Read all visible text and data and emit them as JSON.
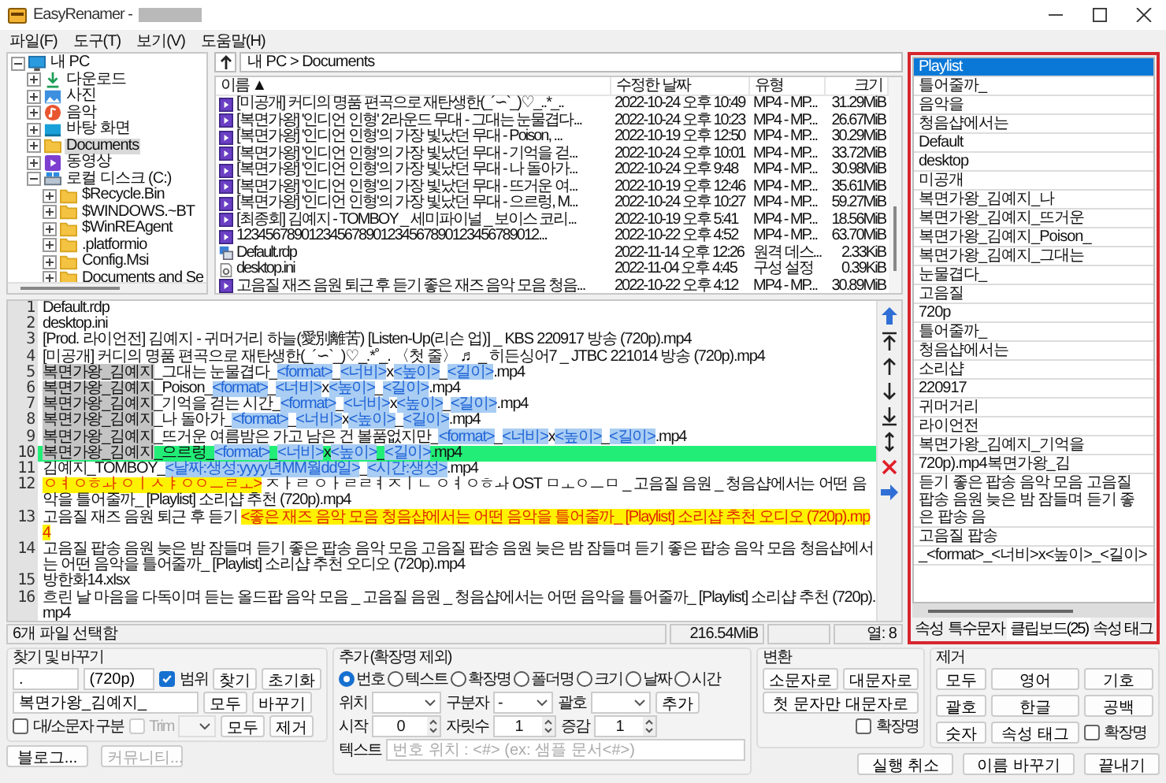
{
  "window": {
    "title": "EasyRenamer -"
  },
  "menu": [
    "파일(F)",
    "도구(T)",
    "보기(V)",
    "도움말(H)"
  ],
  "tree": [
    {
      "label": "내 PC",
      "kind": "pc",
      "expanded": true,
      "selected": false,
      "children": [
        {
          "label": "다운로드",
          "kind": "download",
          "expanded": false,
          "selected": false
        },
        {
          "label": "사진",
          "kind": "picture",
          "expanded": false,
          "selected": false
        },
        {
          "label": "음악",
          "kind": "music",
          "expanded": false,
          "selected": false
        },
        {
          "label": "바탕 화면",
          "kind": "desktop",
          "expanded": false,
          "selected": false
        },
        {
          "label": "Documents",
          "kind": "folder",
          "expanded": false,
          "selected": true
        },
        {
          "label": "동영상",
          "kind": "video",
          "expanded": false,
          "selected": false
        },
        {
          "label": "로컬 디스크 (C:)",
          "kind": "drive",
          "expanded": true,
          "selected": false,
          "children": [
            {
              "label": "$Recycle.Bin",
              "kind": "folder",
              "expanded": false,
              "selected": false
            },
            {
              "label": "$WINDOWS.~BT",
              "kind": "folder",
              "expanded": false,
              "selected": false
            },
            {
              "label": "$WinREAgent",
              "kind": "folder",
              "expanded": false,
              "selected": false
            },
            {
              "label": ".platformio",
              "kind": "folder",
              "expanded": false,
              "selected": false
            },
            {
              "label": "Config.Msi",
              "kind": "folder",
              "expanded": false,
              "selected": false
            },
            {
              "label": "Documents and Se",
              "kind": "folder",
              "expanded": false,
              "selected": false
            }
          ]
        }
      ]
    }
  ],
  "path_bar": {
    "path": "내 PC > Documents"
  },
  "file_list": {
    "columns": [
      "이름 ▲",
      "수정한 날짜",
      "유형",
      "크기"
    ],
    "rows": [
      {
        "kind": "video",
        "cells": [
          "[미공개] 커디의 명품 편곡으로 재탄생한(_´∽`_)♡_..*_..",
          "2022-10-24 오후 10:49",
          "MP4 - MP...",
          "31.29MiB"
        ]
      },
      {
        "kind": "video",
        "cells": [
          "[복면가왕] '인디언 인형' 2라운드 무대 - 그대는 눈물겹다...",
          "2022-10-24 오후 10:23",
          "MP4 - MP...",
          "26.67MiB"
        ]
      },
      {
        "kind": "video",
        "cells": [
          "[복면가왕] '인디언 인형'의 가장 빛났던 무대 - Poison, ...",
          "2022-10-19 오후 12:50",
          "MP4 - MP...",
          "30.29MiB"
        ]
      },
      {
        "kind": "video",
        "cells": [
          "[복면가왕] '인디언 인형'의 가장 빛났던 무대 - 기억을 걷...",
          "2022-10-24 오후 10:01",
          "MP4 - MP...",
          "33.72MiB"
        ]
      },
      {
        "kind": "video",
        "cells": [
          "[복면가왕] '인디언 인형'의 가장 빛났던 무대 - 나 돌아가...",
          "2022-10-24 오후 9:48",
          "MP4 - MP...",
          "30.98MiB"
        ]
      },
      {
        "kind": "video",
        "cells": [
          "[복면가왕] '인디언 인형'의 가장 빛났던 무대 - 뜨거운 여...",
          "2022-10-19 오후 12:46",
          "MP4 - MP...",
          "35.61MiB"
        ]
      },
      {
        "kind": "video",
        "cells": [
          "[복면가왕] '인디언 인형'의 가장 빛났던 무대 - 으르렁, M...",
          "2022-10-24 오후 10:27",
          "MP4 - MP...",
          "59.27MiB"
        ]
      },
      {
        "kind": "video",
        "cells": [
          "[최종회] 김예지 - TOMBOY _ 세미파이널 _ 보이스 코리...",
          "2022-10-19 오후 5:41",
          "MP4 - MP...",
          "18.56MiB"
        ]
      },
      {
        "kind": "video",
        "cells": [
          "123456789012345678901234567890123456789012...",
          "2022-10-22 오후 4:52",
          "MP4 - MP...",
          "63.70MiB"
        ]
      },
      {
        "kind": "remote",
        "cells": [
          "Default.rdp",
          "2022-11-14 오후 12:26",
          "원격 데스...",
          "2.33KiB"
        ]
      },
      {
        "kind": "settings",
        "cells": [
          "desktop.ini",
          "2022-11-04 오후 4:45",
          "구성 설정",
          "0.39KiB"
        ]
      },
      {
        "kind": "video",
        "cells": [
          "고음질 재즈 음원 퇴근 후 듣기 좋은 재즈 음악 모음 청음...",
          "2022-10-22 오후 4:12",
          "MP4 - MP...",
          "30.89MiB"
        ]
      }
    ]
  },
  "editor": {
    "lines": [
      {
        "number": "1",
        "selected": false,
        "segments": [
          {
            "kind": "plain",
            "text": "Default.rdp"
          }
        ]
      },
      {
        "number": "2",
        "selected": false,
        "segments": [
          {
            "kind": "plain",
            "text": "desktop.ini"
          }
        ]
      },
      {
        "number": "3",
        "selected": false,
        "segments": [
          {
            "kind": "plain",
            "text": "[Prod. 라이언전] 김예지 - 귀머거리 하늘(愛別離苦) [Listen-Up(리슨 업)] _ KBS 220917 방송 (720p).mp4"
          }
        ]
      },
      {
        "number": "4",
        "selected": false,
        "segments": [
          {
            "kind": "plain",
            "text": "[미공개] 커디의 명품 편곡으로 재탄생한(_´∽`_)♡_.*˚_. 〈첫 줄〉 ♬ _ 히든싱어7 _ JTBC 221014 방송 (720p).mp4"
          }
        ]
      },
      {
        "number": "5",
        "selected": false,
        "segments": [
          {
            "kind": "sel",
            "text": "복면가왕_김예지"
          },
          {
            "kind": "plain",
            "text": "_그대는 눈물겹다_"
          },
          {
            "kind": "tag",
            "text": "<format>"
          },
          {
            "kind": "plain",
            "text": "_"
          },
          {
            "kind": "tag",
            "text": "<너비>"
          },
          {
            "kind": "plain",
            "text": "x"
          },
          {
            "kind": "tag",
            "text": "<높이>"
          },
          {
            "kind": "plain",
            "text": "_"
          },
          {
            "kind": "tag",
            "text": "<길이>"
          },
          {
            "kind": "plain",
            "text": ".mp4"
          }
        ]
      },
      {
        "number": "6",
        "selected": false,
        "segments": [
          {
            "kind": "sel",
            "text": "복면가왕_김예지"
          },
          {
            "kind": "plain",
            "text": "_Poison_"
          },
          {
            "kind": "tag",
            "text": "<format>"
          },
          {
            "kind": "plain",
            "text": "_"
          },
          {
            "kind": "tag",
            "text": "<너비>"
          },
          {
            "kind": "plain",
            "text": "x"
          },
          {
            "kind": "tag",
            "text": "<높이>"
          },
          {
            "kind": "plain",
            "text": "_"
          },
          {
            "kind": "tag",
            "text": "<길이>"
          },
          {
            "kind": "plain",
            "text": ".mp4"
          }
        ]
      },
      {
        "number": "7",
        "selected": false,
        "segments": [
          {
            "kind": "sel",
            "text": "복면가왕_김예지"
          },
          {
            "kind": "plain",
            "text": "_기억을 걷는 시간_"
          },
          {
            "kind": "tag",
            "text": "<format>"
          },
          {
            "kind": "plain",
            "text": "_"
          },
          {
            "kind": "tag",
            "text": "<너비>"
          },
          {
            "kind": "plain",
            "text": "x"
          },
          {
            "kind": "tag",
            "text": "<높이>"
          },
          {
            "kind": "plain",
            "text": "_"
          },
          {
            "kind": "tag",
            "text": "<길이>"
          },
          {
            "kind": "plain",
            "text": ".mp4"
          }
        ]
      },
      {
        "number": "8",
        "selected": false,
        "segments": [
          {
            "kind": "sel",
            "text": "복면가왕_김예지"
          },
          {
            "kind": "plain",
            "text": "_나 돌아가_"
          },
          {
            "kind": "tag",
            "text": "<format>"
          },
          {
            "kind": "plain",
            "text": "_"
          },
          {
            "kind": "tag",
            "text": "<너비>"
          },
          {
            "kind": "plain",
            "text": "x"
          },
          {
            "kind": "tag",
            "text": "<높이>"
          },
          {
            "kind": "plain",
            "text": "_"
          },
          {
            "kind": "tag",
            "text": "<길이>"
          },
          {
            "kind": "plain",
            "text": ".mp4"
          }
        ]
      },
      {
        "number": "9",
        "selected": false,
        "segments": [
          {
            "kind": "sel",
            "text": "복면가왕_김예지"
          },
          {
            "kind": "plain",
            "text": "_뜨거운 여름밤은 가고 남은 건 볼품없지만_"
          },
          {
            "kind": "tag",
            "text": "<format>"
          },
          {
            "kind": "plain",
            "text": "_"
          },
          {
            "kind": "tag",
            "text": "<너비>"
          },
          {
            "kind": "plain",
            "text": "x"
          },
          {
            "kind": "tag",
            "text": "<높이>"
          },
          {
            "kind": "plain",
            "text": "_"
          },
          {
            "kind": "tag",
            "text": "<길이>"
          },
          {
            "kind": "plain",
            "text": ".mp4"
          }
        ]
      },
      {
        "number": "10",
        "selected": true,
        "segments": [
          {
            "kind": "sel",
            "text": "복면가왕_김예지"
          },
          {
            "kind": "plain",
            "text": "_으르렁_"
          },
          {
            "kind": "tag",
            "text": "<format>"
          },
          {
            "kind": "plain",
            "text": "_"
          },
          {
            "kind": "tag",
            "text": "<너비>"
          },
          {
            "kind": "plain",
            "text": "x"
          },
          {
            "kind": "tag",
            "text": "<높이>"
          },
          {
            "kind": "plain",
            "text": "_"
          },
          {
            "kind": "tag",
            "text": "<길이>"
          },
          {
            "kind": "plain",
            "text": ".mp4"
          }
        ]
      },
      {
        "number": "11",
        "selected": false,
        "segments": [
          {
            "kind": "plain",
            "text": "김예지_TOMBOY_"
          },
          {
            "kind": "tag",
            "text": "<날짜:생성:yyyy년MM월dd일>"
          },
          {
            "kind": "plain",
            "text": "_"
          },
          {
            "kind": "tag",
            "text": "<시간:생성>"
          },
          {
            "kind": "plain",
            "text": ".mp4"
          }
        ]
      },
      {
        "number": "12",
        "selected": false,
        "segments": [
          {
            "kind": "mark",
            "text": "ㅇㅕㅇㅎㅘ ㅇㅣㅅㅑㅇㅇㅡㄹㅗ>"
          },
          {
            "kind": "plain",
            "text": " ㅈㅏㄹ ㅇㅏㄹㄹㅕㅈㅣㄴ ㅇㅕㅇㅎㅘ OST ㅁㅗㅇㅡㅁ _ 고음질 음원 _ 청음샵에서는 어떤 음악을 틀어줄까_ [Playlist] 소리샵 추천 (720p).mp4"
          }
        ]
      },
      {
        "number": "13",
        "selected": false,
        "segments": [
          {
            "kind": "plain",
            "text": "고음질 재즈 음원 퇴근 후 듣기 "
          },
          {
            "kind": "mark",
            "text": "<좋은 재즈 음악 모음 청음샵에서는 어떤 음악을 틀어줄까_ [Playlist] 소리샵 추천 오디오 (720p).mp4"
          }
        ]
      },
      {
        "number": "14",
        "selected": false,
        "segments": [
          {
            "kind": "plain",
            "text": "고음질 팝송 음원 늦은 밤 잠들며 듣기 좋은 팝송 음악 모음 고음질 팝송 음원 늦은 밤 잠들며 듣기 좋은 팝송 음악 모음 청음샵에서는 어떤 음악을 틀어줄까_ [Playlist] 소리샵 추천 오디오 (720p).mp4"
          }
        ]
      },
      {
        "number": "15",
        "selected": false,
        "segments": [
          {
            "kind": "plain",
            "text": "방한화14.xlsx"
          }
        ]
      },
      {
        "number": "16",
        "selected": false,
        "segments": [
          {
            "kind": "plain",
            "text": "흐린 날 마음을 다독이며 듣는 올드팝 음악 모음 _ 고음질 음원 _ 청음샵에서는 어떤 음악을 틀어줄까_ [Playlist] 소리샵 추천 (720p).mp4"
          }
        ]
      }
    ]
  },
  "status_bar": {
    "selection": "6개 파일 선택함",
    "size": "216.54MiB",
    "column": "열: 8"
  },
  "side_panel": {
    "items": [
      {
        "label": "Playlist",
        "selected": true
      },
      {
        "label": "틀어줄까_",
        "selected": false
      },
      {
        "label": "음악을",
        "selected": false
      },
      {
        "label": "청음샵에서는",
        "selected": false
      },
      {
        "label": "Default",
        "selected": false
      },
      {
        "label": "desktop",
        "selected": false
      },
      {
        "label": "미공개",
        "selected": false
      },
      {
        "label": "복면가왕_김예지_나",
        "selected": false
      },
      {
        "label": "복면가왕_김예지_뜨거운",
        "selected": false
      },
      {
        "label": "복면가왕_김예지_Poison_",
        "selected": false
      },
      {
        "label": "복면가왕_김예지_그대는",
        "selected": false
      },
      {
        "label": "눈물겹다_",
        "selected": false
      },
      {
        "label": "고음질",
        "selected": false
      },
      {
        "label": "720p",
        "selected": false
      },
      {
        "label": "틀어줄까_",
        "selected": false
      },
      {
        "label": "청음샵에서는",
        "selected": false
      },
      {
        "label": "소리샵",
        "selected": false
      },
      {
        "label": "220917",
        "selected": false
      },
      {
        "label": "귀머거리",
        "selected": false
      },
      {
        "label": "라이언전",
        "selected": false
      },
      {
        "label": "복면가왕_김예지_기억을",
        "selected": false
      },
      {
        "label": "720p).mp4복면가왕_김",
        "selected": false
      },
      {
        "label": "듣기 좋은 팝송 음악 모음 고음질 팝송 음원 늦은 밤 잠들며 듣기 좋은 팝송 음",
        "selected": false
      },
      {
        "label": "고음질 팝송",
        "selected": false
      },
      {
        "label": "_<format>_<너비>x<높이>_<길이>",
        "selected": false
      }
    ],
    "tabs": [
      {
        "label": "속성",
        "selected": false
      },
      {
        "label": "특수문자",
        "selected": false
      },
      {
        "label": "클립보드(25)",
        "selected": true
      },
      {
        "label": "속성 태그",
        "selected": false
      }
    ]
  },
  "find_replace": {
    "title": "찾기 및 바꾸기",
    "find": {
      "value": "."
    },
    "range_end": {
      "value": "(720p)"
    },
    "range": {
      "label": "범위",
      "checked": true
    },
    "find_button": "찾기",
    "reset_button": "초기화",
    "replace": {
      "value": "복면가왕_김예지_"
    },
    "replace_all_button": "모두",
    "replace_button": "바꾸기",
    "match_case": {
      "label": "대/소문자 구분",
      "checked": false
    },
    "trim": {
      "label": "Trim",
      "checked": false,
      "disabled": true
    },
    "remove_all_button": "모두",
    "remove_button": "제거"
  },
  "links": [
    {
      "label": "블로그...",
      "disabled": false
    },
    {
      "label": "커뮤니티...",
      "disabled": true
    }
  ],
  "add": {
    "title": "추가 (확장명 제외)",
    "options": [
      {
        "label": "번호",
        "selected": true
      },
      {
        "label": "텍스트",
        "selected": false
      },
      {
        "label": "확장명",
        "selected": false
      },
      {
        "label": "폴더명",
        "selected": false
      },
      {
        "label": "크기",
        "selected": false
      },
      {
        "label": "날짜",
        "selected": false
      },
      {
        "label": "시간",
        "selected": false
      }
    ],
    "position": {
      "label": "위치"
    },
    "separator": {
      "label": "구분자",
      "value": "-"
    },
    "bracket": {
      "label": "괄호"
    },
    "add_button": "추가",
    "start": {
      "label": "시작",
      "value": "0"
    },
    "digits": {
      "label": "자릿수",
      "value": "1"
    },
    "step": {
      "label": "증감",
      "value": "1"
    },
    "text": {
      "label": "텍스트",
      "placeholder": "번호 위치 : <#> (ex: 샘플 문서<#>)"
    }
  },
  "convert": {
    "title": "변환",
    "buttons": [
      "소문자로",
      "대문자로",
      "첫 문자만 대문자로"
    ],
    "extension": {
      "label": "확장명",
      "checked": false
    }
  },
  "remove": {
    "title": "제거",
    "buttons": [
      "모두",
      "영어",
      "기호",
      "괄호",
      "한글",
      "공백",
      "숫자",
      "속성 태그"
    ],
    "extension": {
      "label": "확장명",
      "checked": false
    }
  },
  "actions": [
    "실행 취소",
    "이름 바꾸기",
    "끝내기"
  ]
}
